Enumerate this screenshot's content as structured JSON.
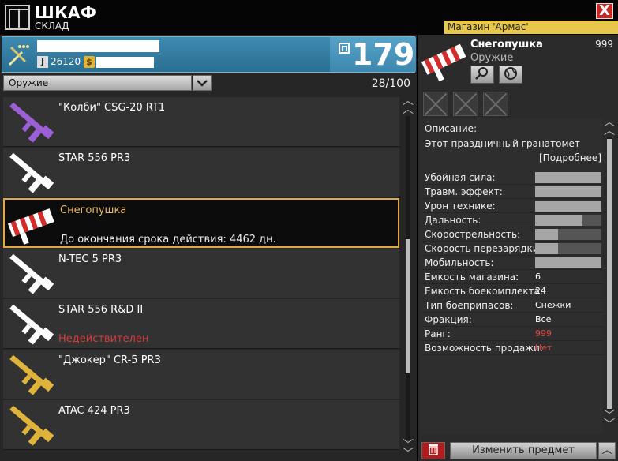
{
  "window": {
    "title": "ШКАФ",
    "subtitle": "СКЛАД",
    "shop_banner": "Магазин 'Армас'",
    "close_label": "X"
  },
  "profile": {
    "j_label": "J",
    "j_value": "26120",
    "coin_label": "$",
    "level": "179"
  },
  "filter": {
    "category": "Оружие",
    "capacity": "28/100"
  },
  "items": [
    {
      "name": "\"Колби\" CSG-20 RT1",
      "desc": "",
      "status": "",
      "color": "#9b5fd6",
      "icon": "rifle-icon"
    },
    {
      "name": "STAR 556 PR3",
      "desc": "",
      "status": "",
      "color": "#ffffff",
      "icon": "rifle-icon"
    },
    {
      "name": "Снегопушка",
      "desc": "До окончания срока действия: 4462 дн.",
      "status": "",
      "color": "#e04040",
      "icon": "snow-launcher-icon"
    },
    {
      "name": "N-TEC 5 PR3",
      "desc": "",
      "status": "",
      "color": "#ffffff",
      "icon": "rifle-icon"
    },
    {
      "name": "STAR 556 R&D II",
      "desc": "",
      "status": "Недействителен",
      "color": "#ffffff",
      "icon": "rifle-icon"
    },
    {
      "name": "\"Джокер\" CR-5 PR3",
      "desc": "",
      "status": "",
      "color": "#e0b43a",
      "icon": "rifle-icon"
    },
    {
      "name": "ATAC 424 PR3",
      "desc": "",
      "status": "",
      "color": "#e0b43a",
      "icon": "rifle-icon"
    }
  ],
  "details": {
    "name": "Снегопушка",
    "category": "Оружие",
    "rank": "999",
    "search_icon": "magnifier-icon",
    "globe_icon": "globe-icon",
    "description_label": "Описание:",
    "description": "Этот праздничный гранатомет",
    "more": "[Подробнее]",
    "bar_stats": [
      {
        "label": "Убойная сила:",
        "value": 1.0
      },
      {
        "label": "Травм. эффект:",
        "value": 1.0
      },
      {
        "label": "Урон технике:",
        "value": 1.0
      },
      {
        "label": "Дальность:",
        "value": 0.72
      },
      {
        "label": "Скорострельность:",
        "value": 0.35
      },
      {
        "label": "Скорость перезарядки:",
        "value": 0.35
      },
      {
        "label": "Мобильность:",
        "value": 1.0
      }
    ],
    "text_stats": [
      {
        "label": "Емкость магазина:",
        "value": "6",
        "red": false
      },
      {
        "label": "Емкость боекомплекта:",
        "value": "24",
        "red": false
      },
      {
        "label": "Тип боеприпасов:",
        "value": "Снежки",
        "red": false
      },
      {
        "label": "Фракция:",
        "value": "Все",
        "red": false
      },
      {
        "label": "Ранг:",
        "value": "999",
        "red": true
      },
      {
        "label": "Возможность продажи:",
        "value": "Нет",
        "red": true
      }
    ]
  },
  "actions": {
    "change_item": "Изменить предмет"
  },
  "colors": {
    "accent_blue": "#3f8ab0",
    "selection": "#e0a84a",
    "warning": "#d83a3a"
  }
}
